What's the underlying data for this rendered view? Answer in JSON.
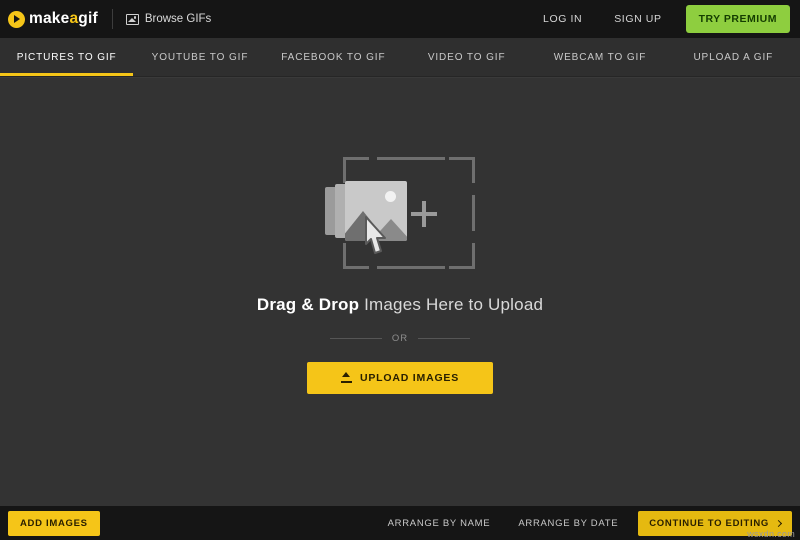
{
  "header": {
    "logo_text_1": "make",
    "logo_text_a": "a",
    "logo_text_2": "gif",
    "browse_label": "Browse GIFs",
    "login_label": "LOG IN",
    "signup_label": "SIGN UP",
    "premium_label": "TRY PREMIUM",
    "accent_color": "#f5c518",
    "premium_color": "#8ece3f"
  },
  "tabs": [
    {
      "label": "PICTURES TO GIF",
      "active": true
    },
    {
      "label": "YOUTUBE TO GIF",
      "active": false
    },
    {
      "label": "FACEBOOK TO GIF",
      "active": false
    },
    {
      "label": "VIDEO TO GIF",
      "active": false
    },
    {
      "label": "WEBCAM TO GIF",
      "active": false
    },
    {
      "label": "UPLOAD A GIF",
      "active": false
    }
  ],
  "main": {
    "headline_bold": "Drag & Drop",
    "headline_rest": " Images Here to Upload",
    "or_label": "OR",
    "upload_button": "UPLOAD IMAGES"
  },
  "footer": {
    "add_images": "ADD IMAGES",
    "arrange_by_name": "ARRANGE BY NAME",
    "arrange_by_date": "ARRANGE BY DATE",
    "continue": "CONTINUE TO EDITING"
  },
  "watermark": "wsxdn.com"
}
